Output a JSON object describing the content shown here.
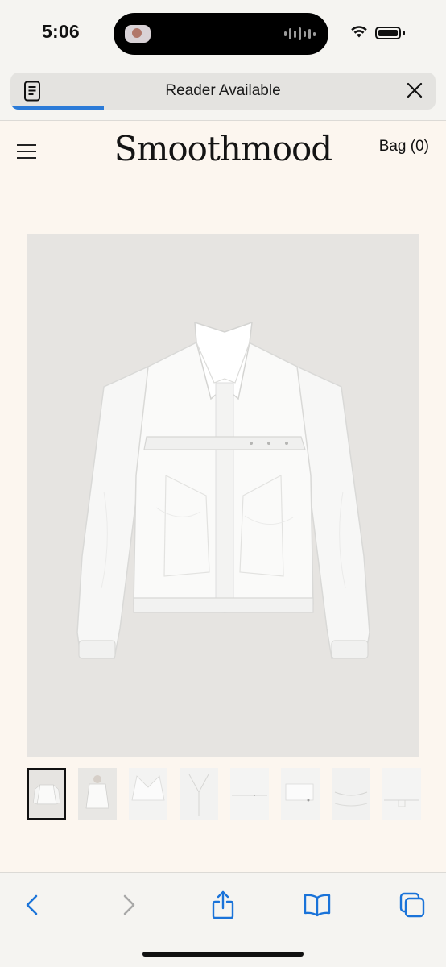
{
  "status_bar": {
    "time": "5:06"
  },
  "reader": {
    "label": "Reader Available",
    "load_progress": 0.22,
    "accent_color": "#2b7bd8"
  },
  "header": {
    "logo": "Smoothmood",
    "bag_label": "Bag (0)"
  },
  "product": {
    "main_image": "white-windbreaker-jacket",
    "thumbnails": [
      {
        "image": "jacket-front",
        "selected": true
      },
      {
        "image": "jacket-on-model",
        "selected": false
      },
      {
        "image": "collar-detail",
        "selected": false
      },
      {
        "image": "zipper-detail",
        "selected": false
      },
      {
        "image": "chest-flap-detail",
        "selected": false
      },
      {
        "image": "sleeve-detail",
        "selected": false
      },
      {
        "image": "fabric-detail",
        "selected": false
      },
      {
        "image": "hem-detail",
        "selected": false
      }
    ]
  },
  "toolbar": {
    "items": [
      "back-icon",
      "forward-icon",
      "share-icon",
      "bookmarks-icon",
      "tabs-icon"
    ],
    "accent_color": "#1a73d9"
  }
}
